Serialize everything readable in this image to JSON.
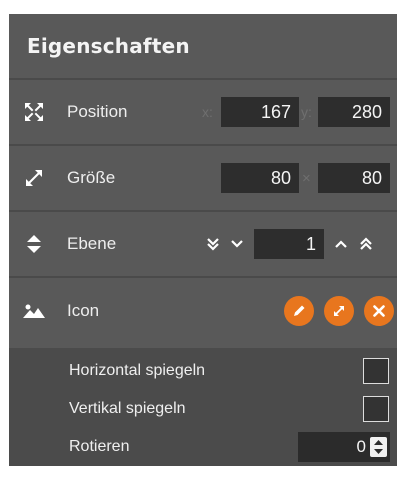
{
  "panel": {
    "title": "Eigenschaften"
  },
  "position": {
    "label": "Position",
    "icon": "move-arrows-icon",
    "x_label": "x:",
    "x_value": "167",
    "y_label": "y:",
    "y_value": "280"
  },
  "size": {
    "label": "Größe",
    "icon": "resize-diagonal-icon",
    "width_value": "80",
    "separator": "×",
    "height_value": "80"
  },
  "layer": {
    "label": "Ebene",
    "icon": "up-down-icon",
    "value": "1"
  },
  "icon_row": {
    "label": "Icon",
    "icon": "image-icon",
    "accent_color": "#e8761e",
    "buttons": [
      "edit-icon",
      "expand-icon",
      "close-icon"
    ]
  },
  "options": {
    "flip_horizontal": {
      "label": "Horizontal spiegeln",
      "checked": false
    },
    "flip_vertical": {
      "label": "Vertikal spiegeln",
      "checked": false
    },
    "rotate": {
      "label": "Rotieren",
      "value": "0"
    }
  }
}
